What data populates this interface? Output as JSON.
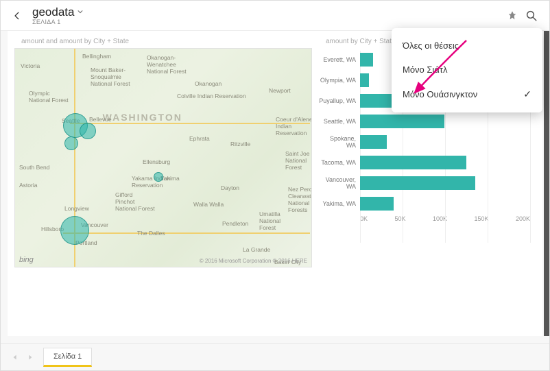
{
  "header": {
    "title": "geodata",
    "subtitle": "ΣΕΛΙΔΑ 1"
  },
  "popup": {
    "items": [
      {
        "label": "Όλες οι θέσεις",
        "checked": false
      },
      {
        "label": "Μόνο Σιάτλ",
        "checked": false
      },
      {
        "label": "Μόνο Ουάσινγκτον",
        "checked": true
      }
    ]
  },
  "map": {
    "title": "amount and amount by City + State",
    "state_label": "WASHINGTON",
    "places": {
      "bellingham": "Bellingham",
      "victoria": "Victoria",
      "mtbaker": "Mount Baker-\nSnoqualmie\nNational Forest",
      "okanogan_wen": "Okanogan-\nWenatchee\nNational Forest",
      "okanogan": "Okanogan",
      "newport": "Newport",
      "colville": "Colville Indian Reservation",
      "coeur": "Coeur d'Alene\nIndian\nReservation",
      "seattle": "Seattle",
      "bellevue": "Bellevue",
      "ephrata": "Ephrata",
      "ritzville": "Ritzville",
      "stjoe": "Saint Joe\nNational\nForest",
      "ellensburg": "Ellensburg",
      "yakima": "Yakima",
      "dayton": "Dayton",
      "wallawalla": "Walla Walla",
      "pendleton": "Pendleton",
      "lagrande": "La Grande",
      "bakercity": "Baker City",
      "umatilla": "Umatilla\nNational\nForest",
      "nezperce": "Nez Perce-\nClearwater\nNational\nForests",
      "gifford": "Gifford\nPinchot\nNational Forest",
      "yakama": "Yakama Indian\nReservation",
      "hillsboro": "Hillsboro",
      "vancouver": "Vancouver",
      "portland": "Portland",
      "thedalles": "The Dalles",
      "longview": "Longview",
      "astoria": "Astoria",
      "southbend": "South Bend",
      "olympic": "Olympic\nNational Forest"
    },
    "bing": "bing",
    "copyright": "© 2016 Microsoft Corporation © 2016 HERE"
  },
  "chart_data": {
    "type": "bar",
    "title": "amount by City + State",
    "xlabel": "",
    "ylabel": "",
    "xlim": [
      0,
      200000
    ],
    "ticks": [
      "0K",
      "50K",
      "100K",
      "150K",
      "200K"
    ],
    "categories": [
      "Everett, WA",
      "Olympia, WA",
      "Puyallup, WA",
      "Seattle, WA",
      "Spokane, WA",
      "Tacoma, WA",
      "Vancouver, WA",
      "Yakima, WA"
    ],
    "values": [
      15000,
      10000,
      130000,
      95000,
      30000,
      120000,
      130000,
      38000
    ]
  },
  "footer": {
    "tab": "Σελίδα 1"
  }
}
